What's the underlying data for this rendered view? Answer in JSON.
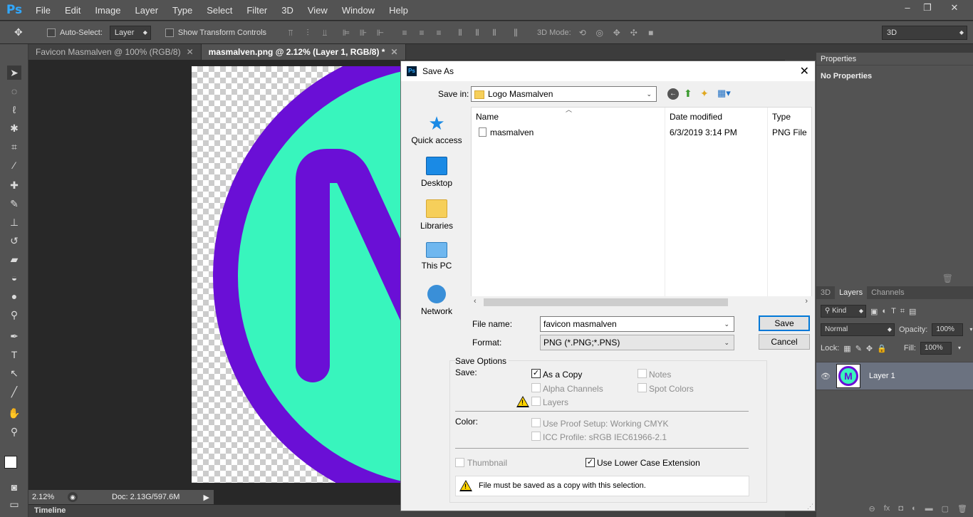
{
  "app": {
    "logo": "Ps",
    "menu": [
      "File",
      "Edit",
      "Image",
      "Layer",
      "Type",
      "Select",
      "Filter",
      "3D",
      "View",
      "Window",
      "Help"
    ],
    "window_controls": [
      "–",
      "❐",
      "✕"
    ]
  },
  "options_bar": {
    "auto_select_label": "Auto-Select:",
    "auto_select_value": "Layer",
    "transform_label": "Show Transform Controls",
    "mode_3d_label": "3D Mode:",
    "workspace_value": "3D"
  },
  "tabs": [
    {
      "label": "Favicon Masmalven @ 100% (RGB/8)",
      "close": "✕"
    },
    {
      "label": "masmalven.png @ 2.12% (Layer 1, RGB/8) *",
      "close": "✕"
    }
  ],
  "status": {
    "zoom": "2.12%",
    "doc": "Doc: 2.13G/597.6M",
    "timeline": "Timeline"
  },
  "canvas": {
    "letter": "M",
    "ring_color": "#6a0fd6",
    "fill_color": "#38f5bd"
  },
  "properties_panel": {
    "tab": "Properties",
    "empty_text": "No Properties"
  },
  "layers_panel": {
    "tabs": [
      "3D",
      "Layers",
      "Channels"
    ],
    "kind_label": "Kind",
    "blend_mode": "Normal",
    "opacity_label": "Opacity:",
    "opacity_value": "100%",
    "lock_label": "Lock:",
    "fill_label": "Fill:",
    "fill_value": "100%",
    "layer_name": "Layer 1",
    "thumb_letter": "M"
  },
  "dialog": {
    "title": "Save As",
    "close": "✕",
    "save_in_label": "Save in:",
    "save_in_value": "Logo Masmalven",
    "places": [
      "Quick access",
      "Desktop",
      "Libraries",
      "This PC",
      "Network"
    ],
    "columns": {
      "name": "Name",
      "date": "Date modified",
      "type": "Type"
    },
    "files": [
      {
        "name": "masmalven",
        "date": "6/3/2019 3:14 PM",
        "type": "PNG File"
      }
    ],
    "file_name_label": "File name:",
    "file_name_value": "favicon masmalven",
    "format_label": "Format:",
    "format_value": "PNG (*.PNG;*.PNS)",
    "save_button": "Save",
    "cancel_button": "Cancel",
    "save_options_title": "Save Options",
    "save_label": "Save:",
    "as_copy": "As a Copy",
    "notes": "Notes",
    "alpha_channels": "Alpha Channels",
    "spot_colors": "Spot Colors",
    "layers": "Layers",
    "color_label": "Color:",
    "use_proof": "Use Proof Setup:  Working CMYK",
    "icc_profile": "ICC Profile:  sRGB IEC61966-2.1",
    "thumbnail": "Thumbnail",
    "lower_case": "Use Lower Case Extension",
    "warning": "File must be saved as a copy with this selection."
  }
}
